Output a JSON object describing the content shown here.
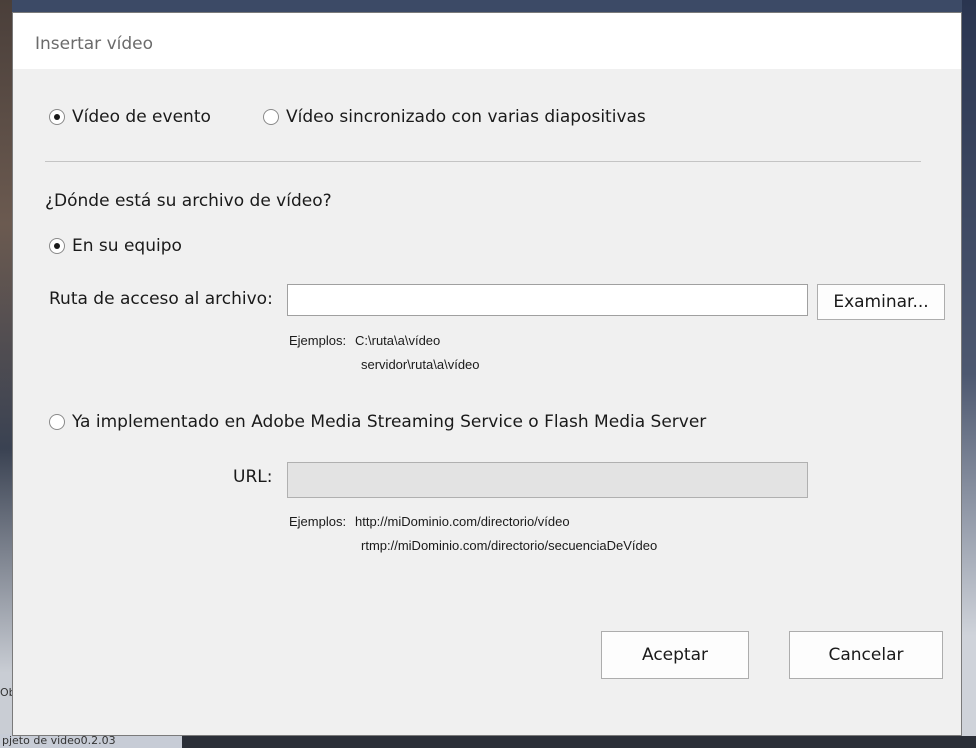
{
  "background": {
    "taskbar_item": "pjeto de video0.2.03",
    "side_label": "Ob"
  },
  "dialog": {
    "title": "Insertar vídeo",
    "video_type": {
      "option_event": "Vídeo de evento",
      "option_sync": "Vídeo sincronizado con varias diapositivas",
      "selected": "Vídeo de evento"
    },
    "location_question": "¿Dónde está su archivo de vídeo?",
    "local": {
      "option_label": "En su equipo",
      "selected": true,
      "path_label": "Ruta de acceso al archivo:",
      "path_value": "",
      "browse_label": "Examinar...",
      "examples_prefix": "Ejemplos:",
      "example_1": "C:\\ruta\\a\\vídeo",
      "example_2": "servidor\\ruta\\a\\vídeo"
    },
    "server": {
      "option_label": "Ya implementado en Adobe Media Streaming Service o Flash Media Server",
      "selected": false,
      "url_label": "URL:",
      "url_value": "",
      "examples_prefix": "Ejemplos:",
      "example_1": "http://miDominio.com/directorio/vídeo",
      "example_2": "rtmp://miDominio.com/directorio/secuenciaDeVídeo"
    },
    "buttons": {
      "ok": "Aceptar",
      "cancel": "Cancelar"
    }
  }
}
